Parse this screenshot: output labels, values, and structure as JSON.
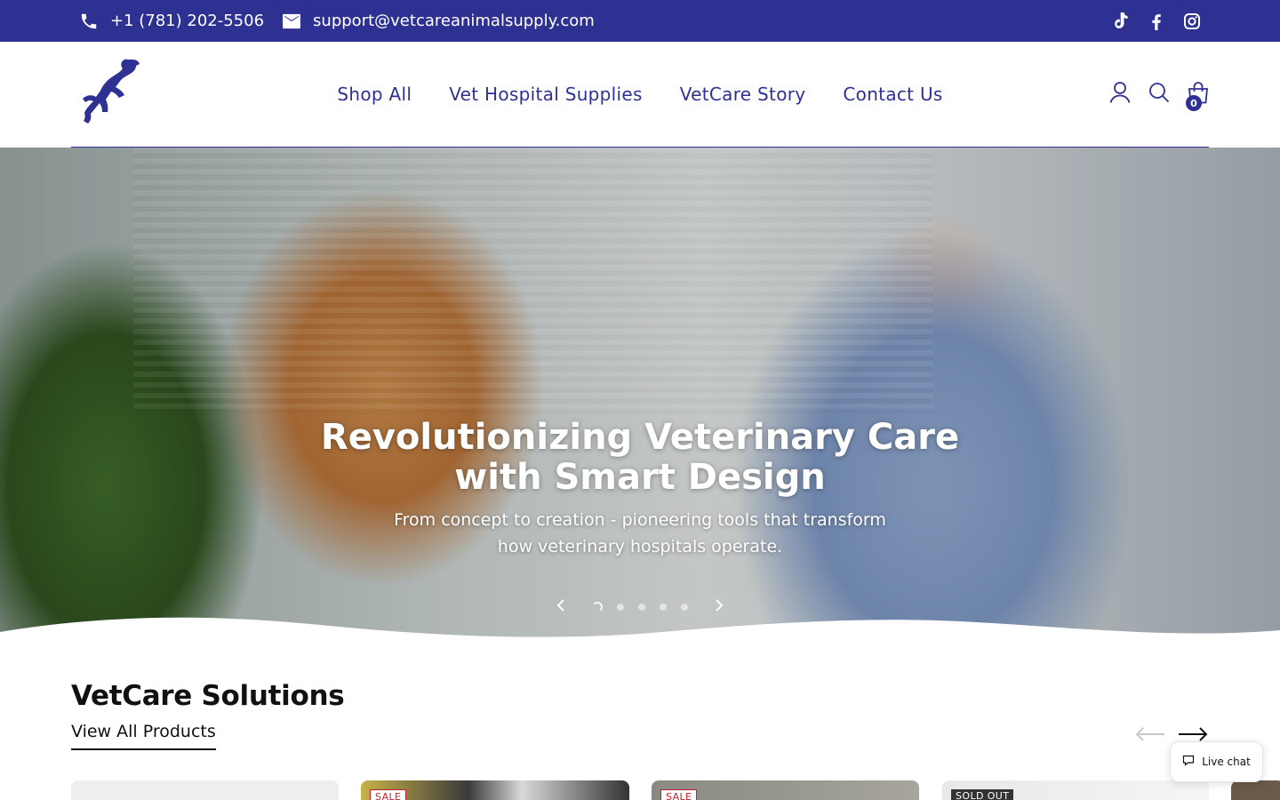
{
  "topbar": {
    "phone": "+1 (781) 202-5506",
    "email": "support@vetcareanimalsupply.com",
    "social_icons": [
      "tiktok-icon",
      "facebook-icon",
      "instagram-icon"
    ]
  },
  "header": {
    "logo_icon": "jumping-dog-logo",
    "nav": [
      "Shop All",
      "Vet Hospital Supplies",
      "VetCare Story",
      "Contact Us"
    ],
    "cart_count": "0",
    "icons": [
      "account-icon",
      "search-icon",
      "cart-icon"
    ]
  },
  "hero": {
    "title_line1": "Revolutionizing Veterinary Care",
    "title_line2": "with Smart Design",
    "subtitle": "From concept to creation - pioneering tools that transform how veterinary hospitals operate.",
    "slide_count": 5,
    "active_slide": 1
  },
  "solutions": {
    "title": "VetCare Solutions",
    "view_all": "View All Products",
    "cards": [
      {
        "badge": ""
      },
      {
        "badge": "SALE"
      },
      {
        "badge": "SALE"
      },
      {
        "badge": "SOLD OUT"
      },
      {
        "badge": ""
      }
    ]
  },
  "livechat": {
    "label": "Live chat"
  },
  "colors": {
    "brand": "#2f3192",
    "sale": "#c0232b"
  }
}
